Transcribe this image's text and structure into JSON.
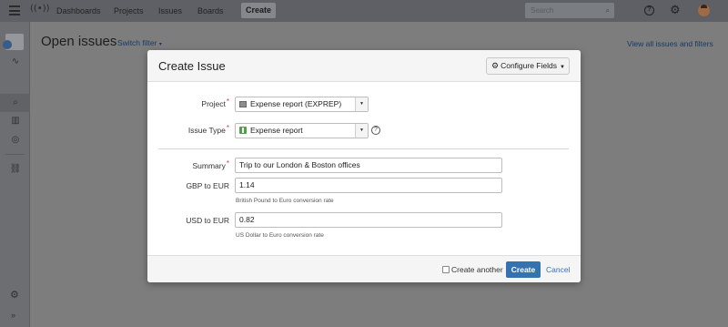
{
  "nav": {
    "items": [
      "Dashboards",
      "Projects",
      "Issues",
      "Boards"
    ],
    "create_label": "Create",
    "search_placeholder": "Search"
  },
  "page": {
    "title": "Open issues",
    "switch_filter": "Switch filter",
    "view_all": "View all issues and filters"
  },
  "dialog": {
    "title": "Create Issue",
    "configure_fields": "Configure Fields",
    "project_label": "Project",
    "project_value": "Expense report (EXPREP)",
    "issue_type_label": "Issue Type",
    "issue_type_value": "Expense report",
    "summary_label": "Summary",
    "summary_value": "Trip to our London & Boston offices",
    "gbp_label": "GBP to EUR",
    "gbp_value": "1.14",
    "gbp_hint": "British Pound to Euro conversion rate",
    "usd_label": "USD to EUR",
    "usd_value": "0.82",
    "usd_hint": "US Dollar to Euro conversion rate",
    "create_another": "Create another",
    "create_button": "Create",
    "cancel": "Cancel",
    "required_marker": "*"
  },
  "icons": {
    "menu": "menu-icon",
    "logo": "broadcast-logo-icon",
    "search": "search-icon",
    "help": "help-icon",
    "settings": "gear-icon",
    "avatar": "user-avatar"
  },
  "colors": {
    "primary_button": "#3572b0",
    "link": "#3572b0",
    "required": "#d04437",
    "issue_type_green": "#47a548"
  }
}
